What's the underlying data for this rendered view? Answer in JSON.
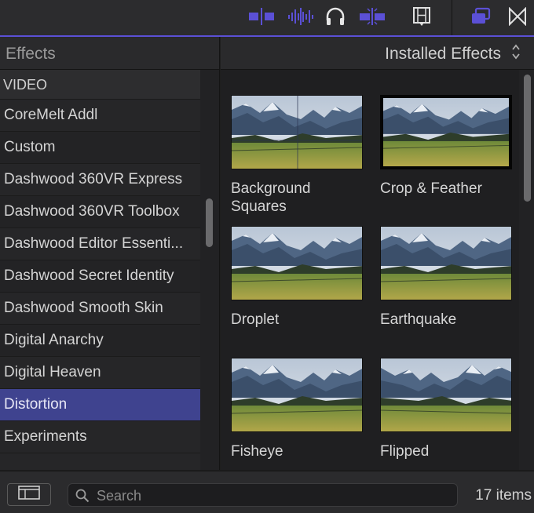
{
  "toolbar": {
    "icons": [
      "inspector-audio-video-icon",
      "audio-waveform-icon",
      "headphones-icon",
      "snapping-icon",
      "filmstrip-icon",
      "browser-toggle-icon",
      "transitions-icon"
    ],
    "accent": "#5b50d6"
  },
  "sidebar": {
    "title": "Effects",
    "section": "VIDEO",
    "items": [
      {
        "label": "CoreMelt Addl"
      },
      {
        "label": "Custom"
      },
      {
        "label": "Dashwood 360VR Express"
      },
      {
        "label": "Dashwood 360VR Toolbox"
      },
      {
        "label": "Dashwood Editor Essenti..."
      },
      {
        "label": "Dashwood Secret Identity"
      },
      {
        "label": "Dashwood Smooth Skin"
      },
      {
        "label": "Digital Anarchy"
      },
      {
        "label": "Digital Heaven"
      },
      {
        "label": "Distortion",
        "selected": true
      },
      {
        "label": "Experiments"
      }
    ],
    "selected_color": "#3f438f"
  },
  "browser": {
    "title": "Installed Effects",
    "effects": [
      {
        "label": "Background Squares"
      },
      {
        "label": "Crop & Feather",
        "selected": true
      },
      {
        "label": "Droplet"
      },
      {
        "label": "Earthquake"
      },
      {
        "label": "Fisheye"
      },
      {
        "label": "Flipped"
      }
    ]
  },
  "footer": {
    "search_placeholder": "Search",
    "search_value": "",
    "item_count": "17 items"
  }
}
